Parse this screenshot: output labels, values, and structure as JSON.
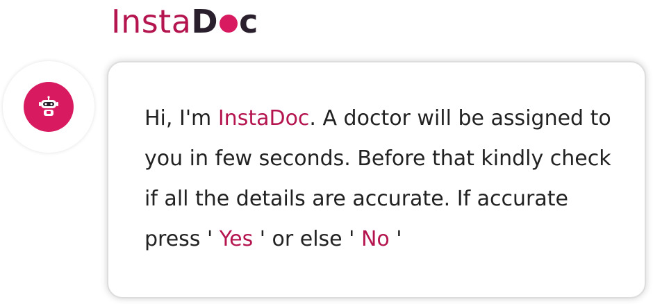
{
  "brand": {
    "prefix": "Insta",
    "suffix_start": "D",
    "suffix_end": "c"
  },
  "avatar": {
    "icon": "robot-icon"
  },
  "message": {
    "part1": "Hi, I'm ",
    "name": "InstaDoc",
    "part2": ". A doctor will be assigned to you in few seconds. Before that kindly check if all the details are accurate. If accurate press ' ",
    "yes": "Yes",
    "part3": " ' or else ' ",
    "no": "No",
    "part4": " '"
  },
  "colors": {
    "accent": "#b5154f",
    "brand_dark": "#2a1f2d",
    "avatar_bg": "#d81b60"
  }
}
